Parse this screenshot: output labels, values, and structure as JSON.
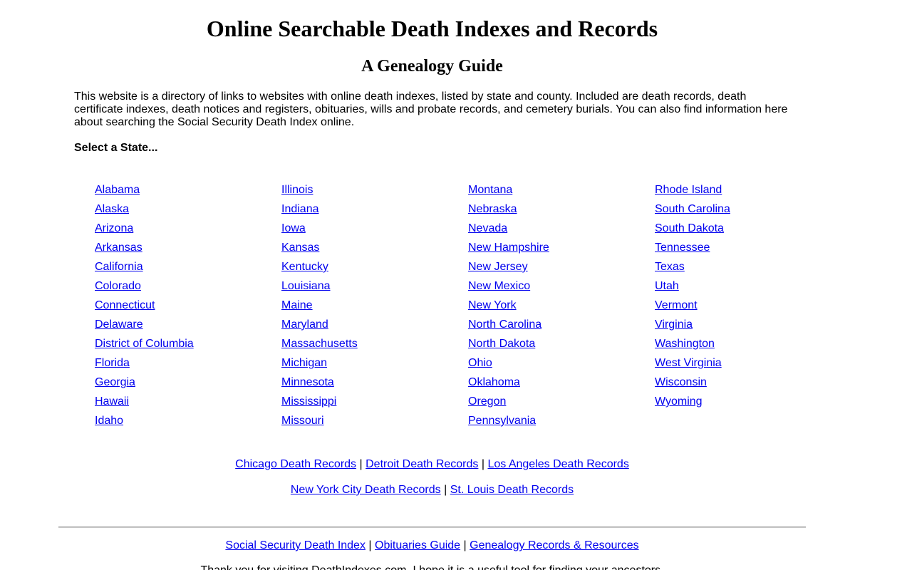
{
  "page": {
    "title": "Online Searchable Death Indexes and Records",
    "subtitle": "A Genealogy Guide",
    "intro": "This website is a directory of links to websites with online death indexes, listed by state and county. Included are death records, death certificate indexes, death notices and registers, obituaries, wills and probate records, and cemetery burials. You can also find information here about searching the Social Security Death Index online.",
    "select_label": "Select a State..."
  },
  "states": {
    "col1": [
      "Alabama",
      "Alaska",
      "Arizona",
      "Arkansas",
      "California",
      "Colorado",
      "Connecticut",
      "Delaware",
      "District of Columbia",
      "Florida",
      "Georgia",
      "Hawaii",
      "Idaho"
    ],
    "col2": [
      "Illinois",
      "Indiana",
      "Iowa",
      "Kansas",
      "Kentucky",
      "Louisiana",
      "Maine",
      "Maryland",
      "Massachusetts",
      "Michigan",
      "Minnesota",
      "Mississippi",
      "Missouri"
    ],
    "col3": [
      "Montana",
      "Nebraska",
      "Nevada",
      "New Hampshire",
      "New Jersey",
      "New Mexico",
      "New York",
      "North Carolina",
      "North Dakota",
      "Ohio",
      "Oklahoma",
      "Oregon",
      "Pennsylvania"
    ],
    "col4": [
      "Rhode Island",
      "South Carolina",
      "South Dakota",
      "Tennessee",
      "Texas",
      "Utah",
      "Vermont",
      "Virginia",
      "Washington",
      "West Virginia",
      "Wisconsin",
      "Wyoming"
    ]
  },
  "cities": {
    "row1": [
      "Chicago Death Records",
      "Detroit Death Records",
      "Los Angeles Death Records"
    ],
    "row2": [
      "New York City Death Records",
      "St. Louis Death Records"
    ]
  },
  "footer": {
    "links": [
      "Social Security Death Index",
      "Obituaries Guide",
      "Genealogy Records & Resources"
    ],
    "thanks": "Thank you for visiting DeathIndexes.com.  I hope it is a useful tool for finding your ancestors."
  },
  "separator": "|",
  "colors": {
    "link": "#0000ee",
    "text": "#000000",
    "background": "#ffffff",
    "rule": "#999999"
  }
}
